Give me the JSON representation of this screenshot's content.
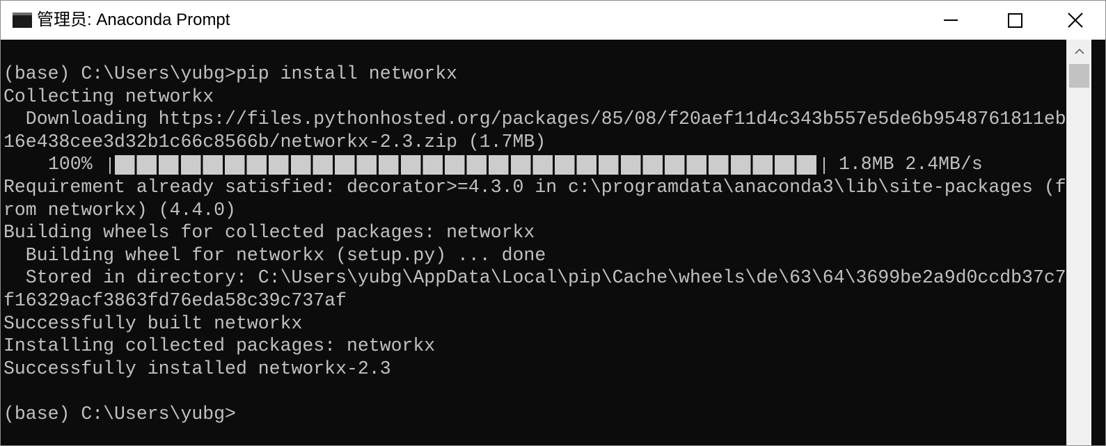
{
  "window": {
    "title": "管理员: Anaconda Prompt",
    "icon": "console-icon",
    "controls": {
      "minimize": "minimize-icon",
      "maximize": "maximize-icon",
      "close": "close-icon"
    }
  },
  "console": {
    "lines_before": [
      "(base) C:\\Users\\yubg>pip install networkx",
      "Collecting networkx",
      "  Downloading https://files.pythonhosted.org/packages/85/08/f20aef11d4c343b557e5de6b9548761811eb",
      "16e438cee3d32b1c66c8566b/networkx-2.3.zip (1.7MB)"
    ],
    "progress": {
      "percent_label": "100%",
      "fraction": 1.0,
      "segments": 32,
      "stats": "1.8MB 2.4MB/s"
    },
    "lines_after": [
      "Requirement already satisfied: decorator>=4.3.0 in c:\\programdata\\anaconda3\\lib\\site-packages (f",
      "rom networkx) (4.4.0)",
      "Building wheels for collected packages: networkx",
      "  Building wheel for networkx (setup.py) ... done",
      "  Stored in directory: C:\\Users\\yubg\\AppData\\Local\\pip\\Cache\\wheels\\de\\63\\64\\3699be2a9d0ccdb37c7",
      "f16329acf3863fd76eda58c39c737af",
      "Successfully built networkx",
      "Installing collected packages: networkx",
      "Successfully installed networkx-2.3",
      "",
      "(base) C:\\Users\\yubg>"
    ]
  },
  "colors": {
    "console_background": "#0c0c0c",
    "console_text": "#c0c0c0",
    "progress_fill": "#cccccc",
    "titlebar_background": "#ffffff"
  }
}
